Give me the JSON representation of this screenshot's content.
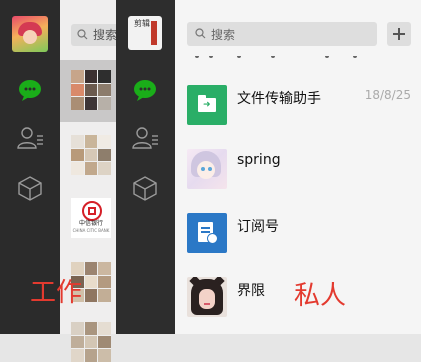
{
  "work_window": {
    "search": {
      "placeholder": "搜索"
    },
    "icons": {
      "chats": "chat-bubble-icon",
      "contacts": "contacts-icon",
      "favorites": "cube-icon"
    },
    "bank_avatar": {
      "line1": "中信银行",
      "line2": "CHINA CITIC BANK"
    }
  },
  "private_window": {
    "account_avatar": {
      "text": "剪辑"
    },
    "search": {
      "placeholder": "搜索"
    },
    "add_button": "+",
    "chats": [
      {
        "name": "文件传输助手",
        "time": "18/8/25",
        "avatar_icon": "file-transfer-icon"
      },
      {
        "name": "spring",
        "time": "",
        "avatar_icon": "anime-girl-avatar"
      },
      {
        "name": "订阅号",
        "time": "",
        "avatar_icon": "subscription-icon"
      },
      {
        "name": "界限",
        "time": "",
        "avatar_icon": "cat-ear-girl-avatar"
      }
    ]
  },
  "annotations": {
    "work": "工作",
    "private": "私人"
  },
  "colors": {
    "sidebar": "#2b2b2b",
    "active_chat_icon": "#1aad19",
    "file_transfer": "#2aae67",
    "subscription": "#2b78c6",
    "annotation": "#e33a2f"
  }
}
